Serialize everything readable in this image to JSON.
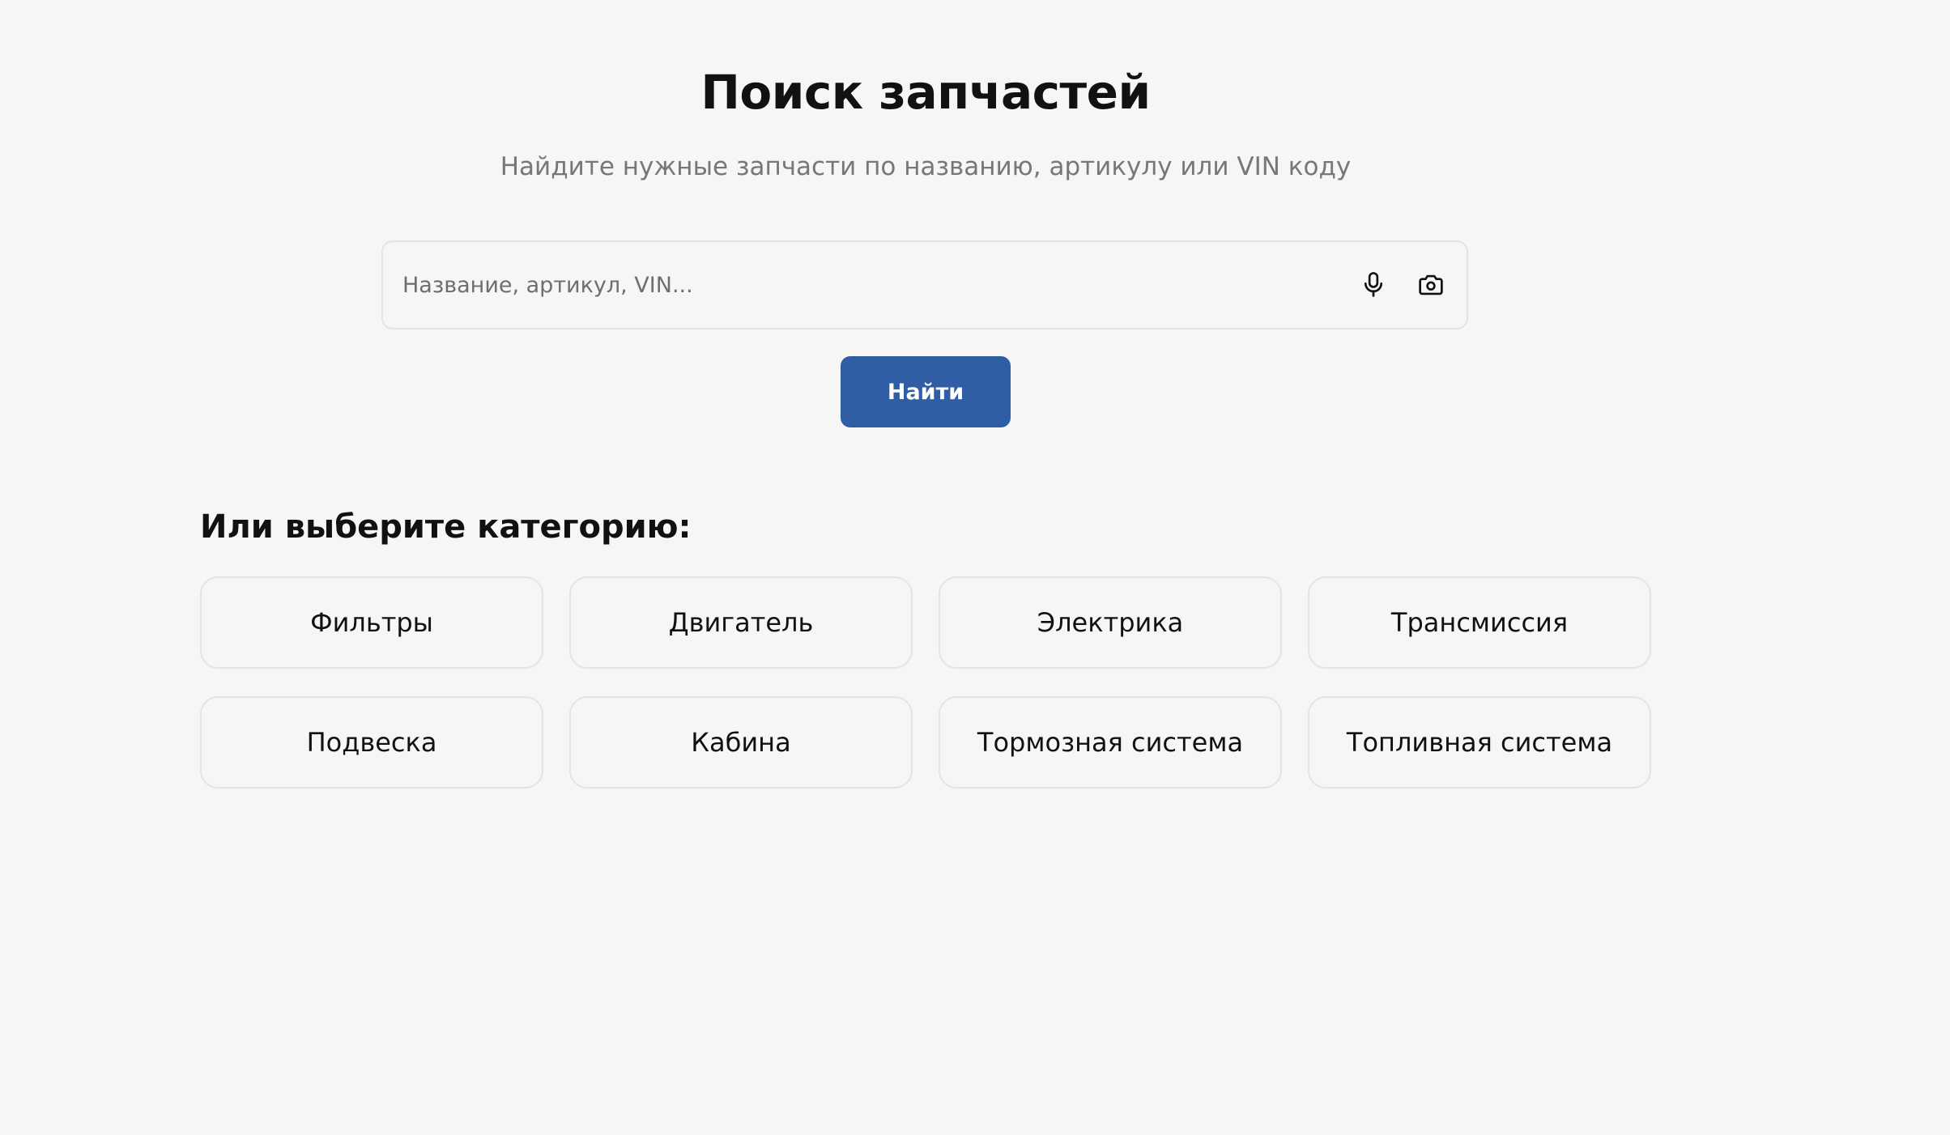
{
  "header": {
    "title": "Поиск запчастей",
    "subtitle": "Найдите нужные запчасти по названию, артикулу или VIN коду"
  },
  "search": {
    "placeholder": "Название, артикул, VIN...",
    "value": "",
    "mic_icon": "microphone-icon",
    "camera_icon": "camera-icon",
    "button_label": "Найти"
  },
  "categories": {
    "heading": "Или выберите категорию:",
    "items": [
      {
        "label": "Фильтры"
      },
      {
        "label": "Двигатель"
      },
      {
        "label": "Электрика"
      },
      {
        "label": "Трансмиссия"
      },
      {
        "label": "Подвеска"
      },
      {
        "label": "Кабина"
      },
      {
        "label": "Тормозная система"
      },
      {
        "label": "Топливная система"
      }
    ]
  },
  "colors": {
    "background": "#f6f6f4",
    "accent": "#2f5ea5",
    "border": "#e4e4e2",
    "muted_text": "#777777"
  }
}
